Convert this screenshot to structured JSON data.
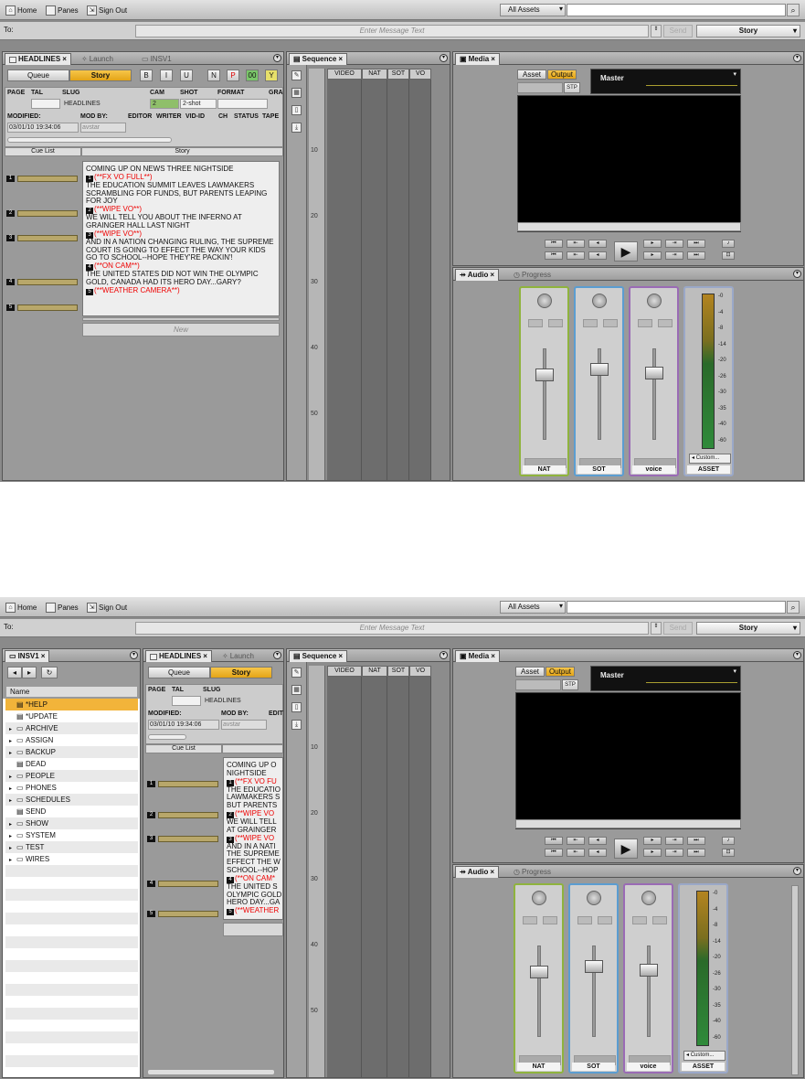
{
  "toolbar": {
    "home_label": "Home",
    "panes_label": "Panes",
    "signout_label": "Sign Out",
    "assets_label": "All Assets"
  },
  "message_bar": {
    "to_label": "To:",
    "placeholder": "Enter Message Text",
    "send_label": "Send",
    "story_label": "Story"
  },
  "rundown": {
    "tabs": [
      "HEADLINES",
      "Launch",
      "INSV1"
    ],
    "queue_label": "Queue",
    "story_label": "Story",
    "format_buttons": [
      "B",
      "I",
      "U",
      "N",
      "P",
      "00",
      "Y"
    ],
    "fields_row1": [
      "PAGE",
      "TAL",
      "SLUG",
      "CAM",
      "SHOT",
      "FORMAT",
      "GRA"
    ],
    "slug_value": "HEADLINES",
    "cam_value": "2",
    "shot_value": "2-shot",
    "fields_row2": [
      "MODIFIED:",
      "MOD BY:",
      "EDITOR",
      "WRITER",
      "VID-ID",
      "CH",
      "STATUS",
      "TAPE"
    ],
    "modified_value": "03/01/10 19:34:06",
    "modby_value": "avstar",
    "cue_header": "Cue List",
    "story_header": "Story",
    "new_label": "New",
    "cue_numbers": [
      "1",
      "2",
      "3",
      "4",
      "5"
    ],
    "story_lines": [
      {
        "type": "text",
        "text": "COMING UP ON NEWS THREE NIGHTSIDE"
      },
      {
        "type": "cue",
        "num": "1",
        "text": "(**FX VO FULL**)"
      },
      {
        "type": "text",
        "text": "THE EDUCATION SUMMIT LEAVES LAWMAKERS SCRAMBLING FOR FUNDS, BUT PARENTS LEAPING FOR JOY"
      },
      {
        "type": "cue",
        "num": "2",
        "text": "(**WIPE VO**)"
      },
      {
        "type": "text",
        "text": "WE WILL TELL YOU ABOUT THE INFERNO AT GRAINGER HALL LAST NIGHT"
      },
      {
        "type": "cue",
        "num": "3",
        "text": "(**WIPE VO**)"
      },
      {
        "type": "text",
        "text": "AND IN A NATION CHANGING RULING, THE SUPREME COURT IS GOING TO EFFECT THE WAY YOUR KIDS GO TO SCHOOL--HOPE THEY'RE PACKIN'!"
      },
      {
        "type": "cue",
        "num": "4",
        "text": "(**ON CAM**)"
      },
      {
        "type": "text",
        "text": "THE UNITED STATES DID NOT WIN THE OLYMPIC GOLD, CANADA HAD ITS HERO DAY...GARY?"
      },
      {
        "type": "cue",
        "num": "5",
        "text": "(**WEATHER CAMERA**)"
      }
    ]
  },
  "sequence": {
    "tab": "Sequence",
    "columns": [
      "VIDEO",
      "NAT",
      "SOT",
      "VO"
    ],
    "ruler_marks": [
      "10",
      "20",
      "30",
      "40",
      "50"
    ]
  },
  "media": {
    "tab": "Media",
    "asset_label": "Asset",
    "output_label": "Output",
    "stp_label": "STP",
    "master_label": "Master"
  },
  "audio": {
    "tab": "Audio",
    "progress_tab": "Progress",
    "channels": [
      "NAT",
      "SOT",
      "voice"
    ],
    "asset_label": "ASSET",
    "custom_label": "Custom...",
    "meter_scale": [
      "-0",
      "-4",
      "-8",
      "-14",
      "-20",
      "-26",
      "-30",
      "-35",
      "-40",
      "-60"
    ]
  },
  "directory": {
    "tab": "INSV1",
    "name_header": "Name",
    "items": [
      "*HELP",
      "*UPDATE",
      "ARCHIVE",
      "ASSIGN",
      "BACKUP",
      "DEAD",
      "PEOPLE",
      "PHONES",
      "SCHEDULES",
      "SEND",
      "SHOW",
      "SYSTEM",
      "TEST",
      "WIRES"
    ]
  },
  "narrow_story_lines": [
    {
      "type": "text",
      "text": "COMING UP O"
    },
    {
      "type": "text",
      "text": "NIGHTSIDE"
    },
    {
      "type": "cue",
      "num": "1",
      "text": "(**FX VO FU"
    },
    {
      "type": "text",
      "text": "THE EDUCATIO"
    },
    {
      "type": "text",
      "text": "LAWMAKERS S"
    },
    {
      "type": "text",
      "text": "BUT PARENTS"
    },
    {
      "type": "cue",
      "num": "2",
      "text": "(**WIPE VO"
    },
    {
      "type": "text",
      "text": "WE WILL TELL"
    },
    {
      "type": "text",
      "text": "AT GRAINGER"
    },
    {
      "type": "cue",
      "num": "3",
      "text": "(**WIPE VO"
    },
    {
      "type": "text",
      "text": "AND IN A NATI"
    },
    {
      "type": "text",
      "text": "THE SUPREME"
    },
    {
      "type": "text",
      "text": "EFFECT THE W"
    },
    {
      "type": "text",
      "text": "SCHOOL--HOP"
    },
    {
      "type": "cue",
      "num": "4",
      "text": "(**ON CAM*"
    },
    {
      "type": "text",
      "text": "THE UNITED S"
    },
    {
      "type": "text",
      "text": "OLYMPIC GOLD"
    },
    {
      "type": "text",
      "text": "HERO DAY...GA"
    },
    {
      "type": "cue",
      "num": "5",
      "text": "(**WEATHER"
    }
  ]
}
